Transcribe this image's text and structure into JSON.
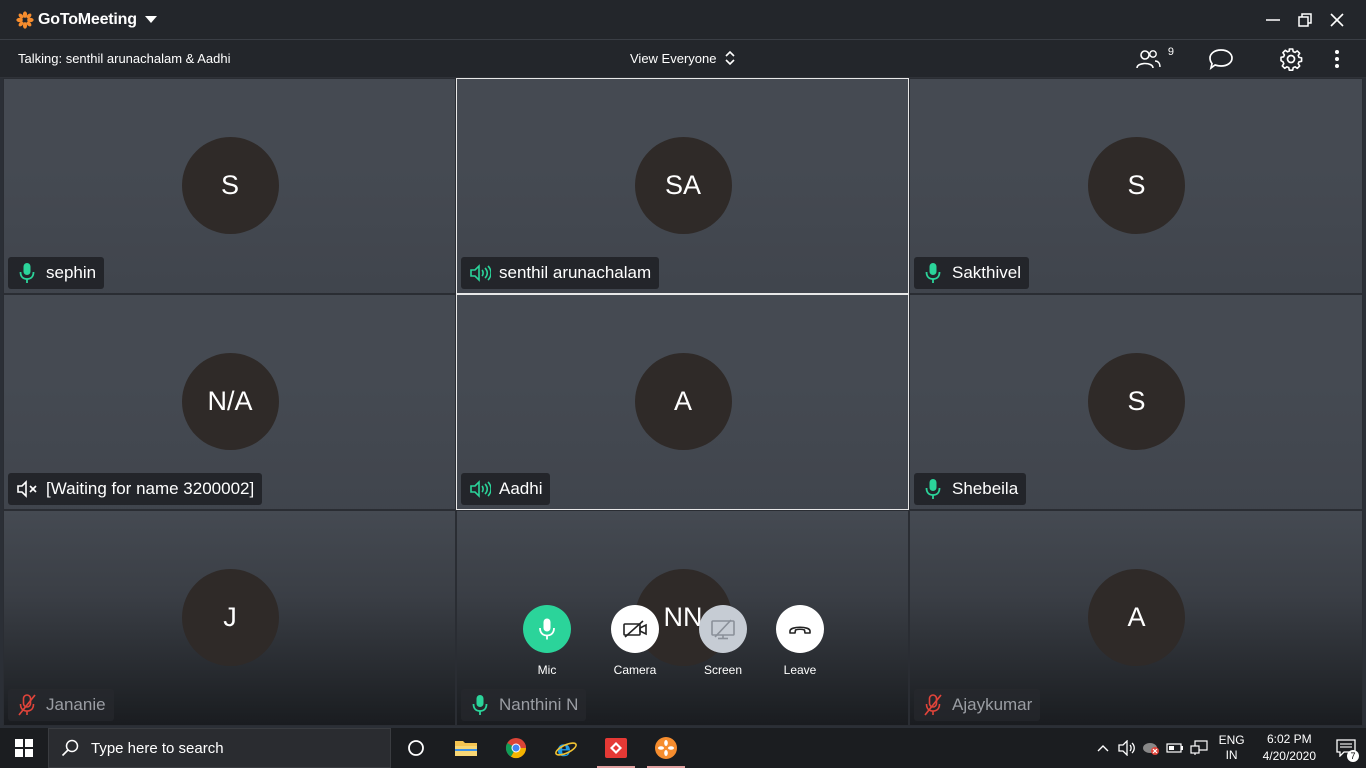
{
  "app": {
    "brand": "GoToMeeting",
    "brand_color": "#f68d2e"
  },
  "toolbar": {
    "talking": "Talking: senthil arunachalam & Aadhi",
    "view_label": "View Everyone",
    "participant_count": "9"
  },
  "tiles": [
    {
      "initials": "S",
      "name": "sephin",
      "audio": "mic-on",
      "active": false
    },
    {
      "initials": "SA",
      "name": "senthil arunachalam",
      "audio": "speaking",
      "active": true
    },
    {
      "initials": "S",
      "name": "Sakthivel",
      "audio": "mic-on",
      "active": false
    },
    {
      "initials": "N/A",
      "name": "[Waiting for name 3200002]",
      "audio": "no-audio",
      "active": false
    },
    {
      "initials": "A",
      "name": "Aadhi",
      "audio": "speaking",
      "active": true
    },
    {
      "initials": "S",
      "name": "Shebeila",
      "audio": "mic-on",
      "active": false
    },
    {
      "initials": "J",
      "name": "Jananie",
      "audio": "muted",
      "active": false
    },
    {
      "initials": "NN",
      "name": "Nanthini N",
      "audio": "mic-on",
      "active": false
    },
    {
      "initials": "A",
      "name": "Ajaykumar",
      "audio": "muted",
      "active": false
    }
  ],
  "controls": {
    "mic": "Mic",
    "camera": "Camera",
    "screen": "Screen",
    "leave": "Leave"
  },
  "colors": {
    "accent_green": "#2bd49a",
    "muted_red": "#e0443a"
  },
  "taskbar": {
    "search_placeholder": "Type here to search",
    "lang_top": "ENG",
    "lang_bottom": "IN",
    "time": "6:02 PM",
    "date": "4/20/2020",
    "notification_count": "7"
  }
}
